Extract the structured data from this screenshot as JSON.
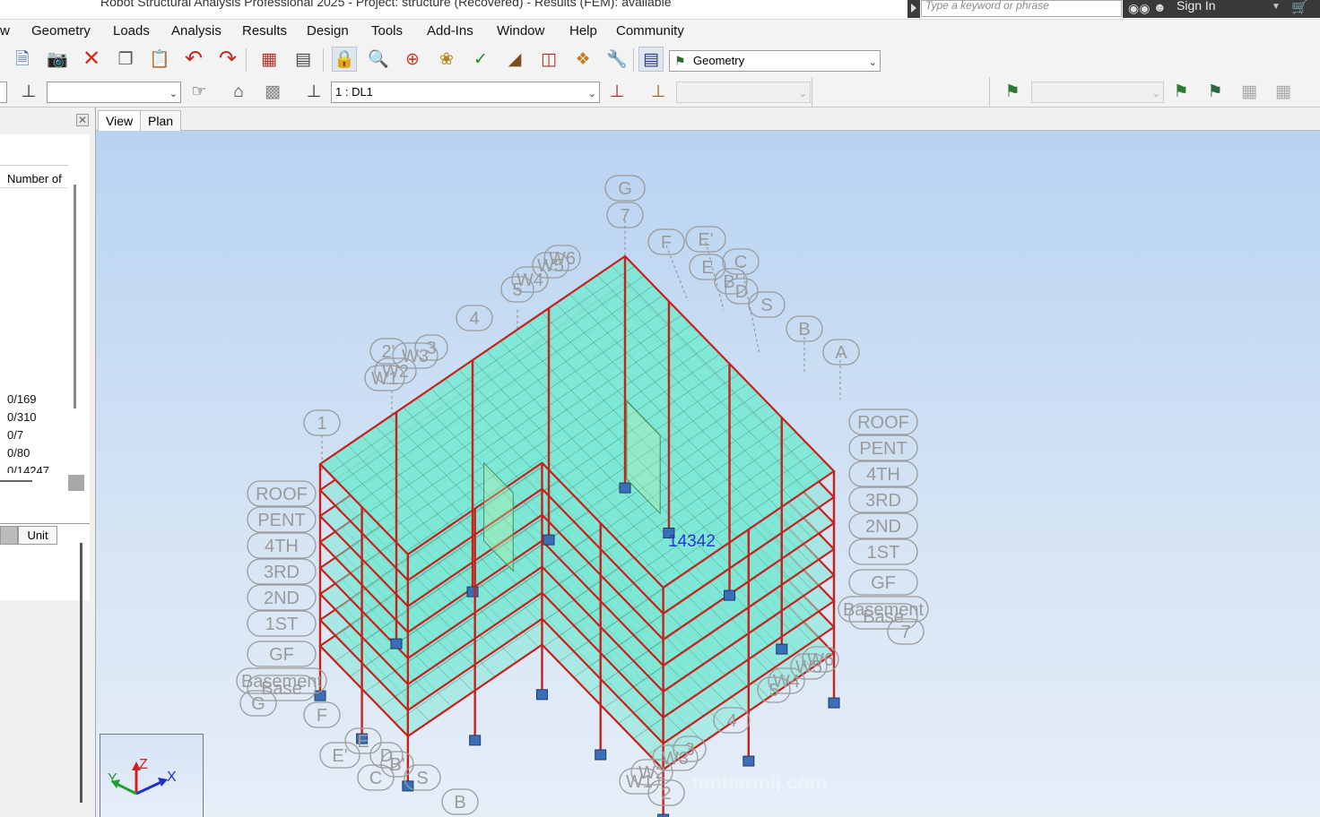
{
  "window": {
    "title": "Robot Structural Analysis Professional 2025 - Project: structure (Recovered) - Results (FEM): available",
    "search_placeholder": "Type a keyword or phrase",
    "sign_in": "Sign In"
  },
  "menu": [
    "w",
    "Geometry",
    "Loads",
    "Analysis",
    "Results",
    "Design",
    "Tools",
    "Add-Ins",
    "Window",
    "Help",
    "Community"
  ],
  "toolbar": {
    "layout_combo": "Geometry",
    "load_case_combo": "1 : DL1"
  },
  "left_panel": {
    "column_header": "Number of",
    "rows": [
      "0/169",
      "0/310",
      "0/7",
      "0/80",
      "0/14247"
    ],
    "unit_header": "Unit"
  },
  "view_tabs": [
    "View",
    "Plan"
  ],
  "model": {
    "node_label": "14342",
    "axis_x": "X",
    "axis_y": "Y",
    "axis_z": "Z",
    "gridline_labels": [
      "G",
      "7",
      "F",
      "E'",
      "E",
      "C",
      "D",
      "B'",
      "S",
      "B",
      "A",
      "4",
      "5",
      "W4",
      "W5",
      "W6",
      "W3",
      "3",
      "2'",
      "W2",
      "W1",
      "1",
      "2"
    ],
    "story_labels": [
      "ROOF",
      "PENT",
      "4TH",
      "3RD",
      "2ND",
      "1ST",
      "GF",
      "Basement",
      "Base"
    ],
    "watermark": "mubarmij.com"
  },
  "colors": {
    "mesh": "#7ee8d6",
    "frame": "#c8201a",
    "support": "#3a6fb8",
    "label": "#9a9a9a",
    "node_label": "#2b35d8"
  }
}
